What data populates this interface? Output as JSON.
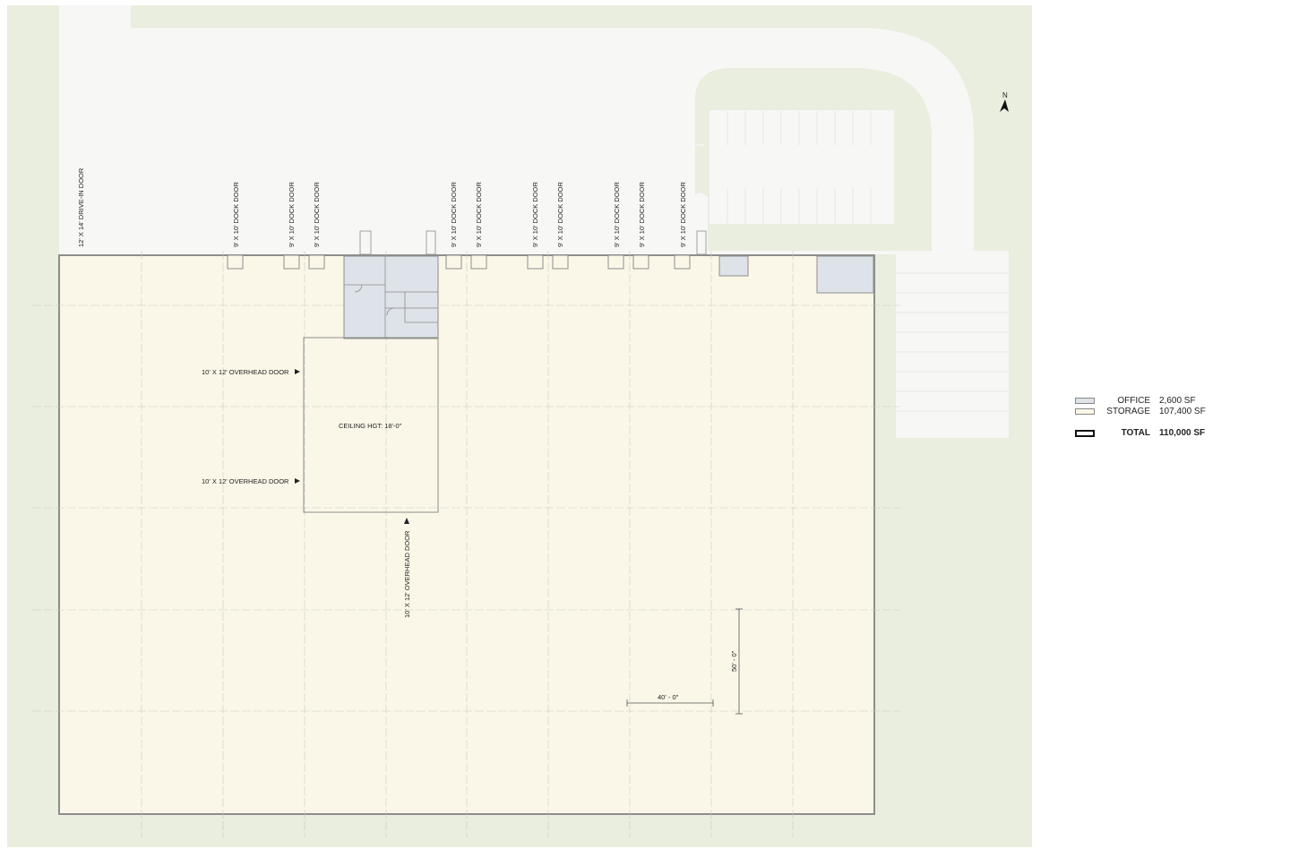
{
  "north_label": "N",
  "door_labels": {
    "drive_in": "12' X 14' DRIVE-IN DOOR",
    "dock": "9' X 10' DOCK DOOR",
    "overhead": "10' X 12' OVERHEAD DOOR"
  },
  "ceiling_label": "CEILING HGT: 18'-0\"",
  "dimensions": {
    "bay_width": "40' - 0\"",
    "bay_depth": "50' - 0\""
  },
  "legend": {
    "items": [
      {
        "name": "OFFICE",
        "value": "2,600 SF",
        "color": "#dde3e8"
      },
      {
        "name": "STORAGE",
        "value": "107,400 SF",
        "color": "#fbf7e8"
      }
    ],
    "total": {
      "name": "TOTAL",
      "value": "110,000 SF"
    }
  },
  "colors": {
    "site_grass": "#e9eedf",
    "pavement": "#f7f7f6",
    "warehouse": "#fbf7e8",
    "office": "#dde3e8",
    "grid": "#c9c9c4",
    "wall": "#8d8d8d"
  }
}
